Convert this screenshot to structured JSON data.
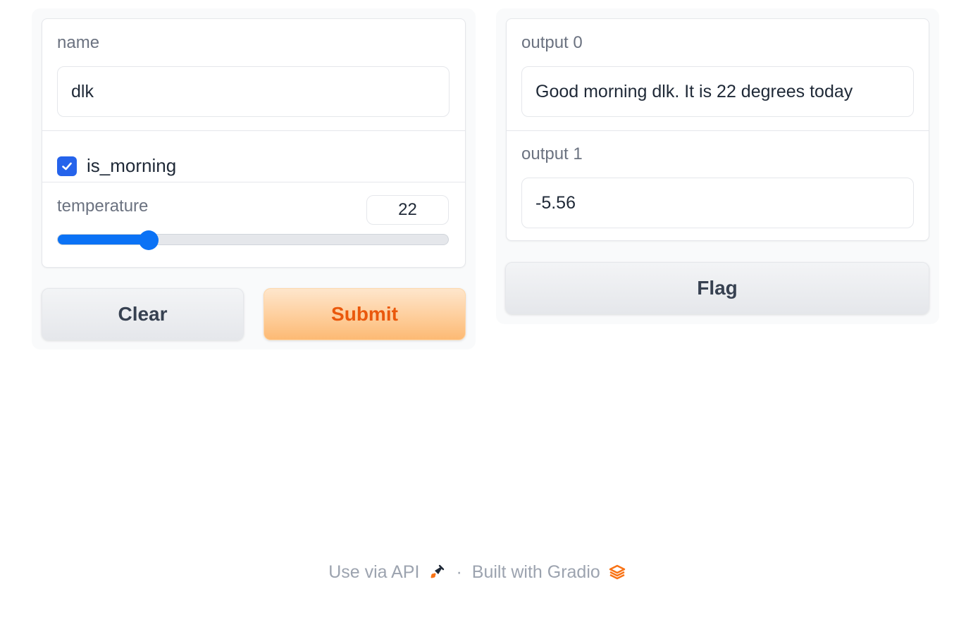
{
  "inputs": {
    "name": {
      "label": "name",
      "value": "dlk"
    },
    "is_morning": {
      "label": "is_morning",
      "checked": true
    },
    "temperature": {
      "label": "temperature",
      "value": "22",
      "level": 0.233
    }
  },
  "buttons": {
    "clear": "Clear",
    "submit": "Submit",
    "flag": "Flag"
  },
  "outputs": {
    "output0": {
      "label": "output 0",
      "value": "Good morning dlk. It is 22 degrees today"
    },
    "output1": {
      "label": "output 1",
      "value": "-5.56"
    }
  },
  "footer": {
    "api_link": "Use via API",
    "separator": "·",
    "built_with": "Built with Gradio"
  },
  "colors": {
    "accent_blue": "#0b72f5",
    "checkbox_blue": "#2563eb",
    "primary_orange": "#ea580c",
    "gradio_orange": "#f97316"
  }
}
